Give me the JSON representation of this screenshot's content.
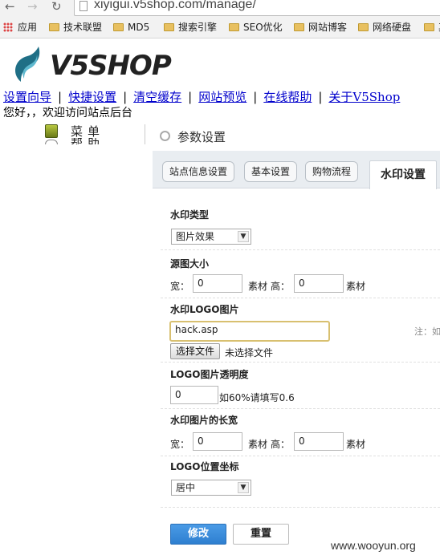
{
  "browser": {
    "url": "xiyigui.v5shop.com/manage/",
    "bookmarks": [
      "应用",
      "技术联盟",
      "MD5",
      "搜索引擎",
      "SEO优化",
      "网站博客",
      "网络硬盘",
      "其他"
    ]
  },
  "logo": {
    "text": "V5SHOP"
  },
  "toplinks": [
    "设置向导",
    "快捷设置",
    "清空缓存",
    "网站预览",
    "在线帮助",
    "关于V5Shop"
  ],
  "separator": "|",
  "greeting": "您好，，欢迎访问站点后台",
  "sidebar": {
    "menu_label": "菜单",
    "help_label": "帮助"
  },
  "panel": {
    "title": "参数设置",
    "tabs": [
      "站点信息设置",
      "基本设置",
      "购物流程",
      "水印设置"
    ],
    "active_tab": "水印设置"
  },
  "form": {
    "watermark_type": {
      "label": "水印类型",
      "value": "图片效果"
    },
    "source_size": {
      "label": "源图大小",
      "width_label": "宽：",
      "width": "0",
      "unit1": "素材",
      "height_label": "高：",
      "height": "0",
      "unit2": "素材"
    },
    "logo_image": {
      "label": "水印LOGO图片",
      "value": "hack.asp",
      "note": "注：如",
      "choose_label": "选择文件",
      "no_file": "未选择文件"
    },
    "logo_opacity": {
      "label": "LOGO图片透明度",
      "value": "0",
      "hint": "如60%请填写0.6"
    },
    "watermark_size": {
      "label": "水印图片的长宽",
      "width_label": "宽：",
      "width": "0",
      "unit1": "素材",
      "height_label": "高：",
      "height": "0",
      "unit2": "素材"
    },
    "logo_position": {
      "label": "LOGO位置坐标",
      "value": "居中"
    }
  },
  "actions": {
    "save": "修改",
    "reset": "重置"
  },
  "watermark": "www.wooyun.org"
}
